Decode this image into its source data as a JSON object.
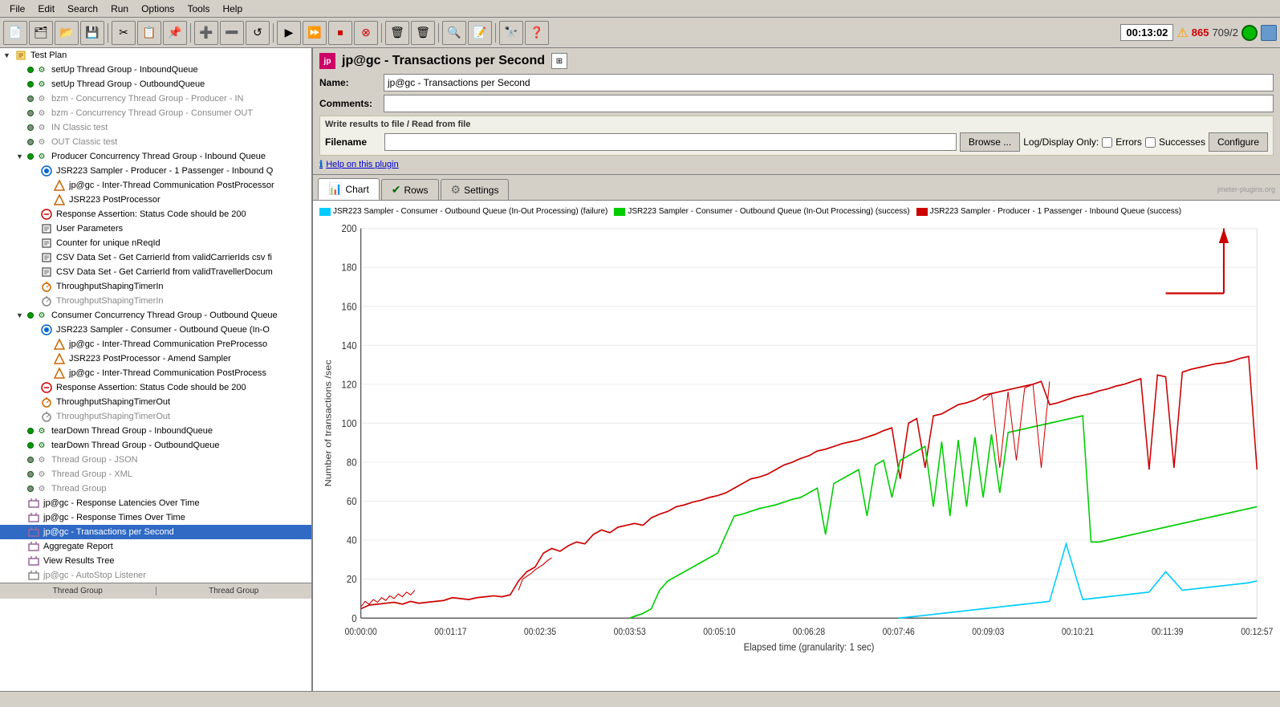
{
  "menubar": {
    "items": [
      "File",
      "Edit",
      "Search",
      "Run",
      "Options",
      "Tools",
      "Help"
    ]
  },
  "toolbar": {
    "timer": "00:13:02",
    "error_count": "865",
    "success_count": "709/2",
    "buttons": [
      "new",
      "open",
      "save",
      "cut",
      "copy",
      "paste",
      "add",
      "remove",
      "reset",
      "play",
      "stop_r",
      "stop",
      "shutdown",
      "clear",
      "clear_all",
      "browse_script",
      "script2",
      "search",
      "help"
    ]
  },
  "plugin": {
    "title": "jp@gc - Transactions per Second",
    "name_label": "Name:",
    "name_value": "jp@gc - Transactions per Second",
    "comments_label": "Comments:",
    "comments_value": "",
    "write_section_title": "Write results to file / Read from file",
    "filename_label": "Filename",
    "filename_value": "",
    "browse_label": "Browse ...",
    "log_display_label": "Log/Display Only:",
    "errors_label": "Errors",
    "successes_label": "Successes",
    "configure_label": "Configure",
    "help_text": "Help on this plugin"
  },
  "tabs": [
    {
      "label": "Chart",
      "active": true
    },
    {
      "label": "Rows",
      "active": false
    },
    {
      "label": "Settings",
      "active": false
    }
  ],
  "legend": [
    {
      "color": "#00ccff",
      "label": "JSR223 Sampler - Consumer - Outbound Queue (In-Out Processing) (failure)"
    },
    {
      "color": "#00cc00",
      "label": "JSR223 Sampler - Consumer - Outbound Queue (In-Out Processing) (success)"
    },
    {
      "color": "#cc0000",
      "label": "JSR223 Sampler - Producer - 1 Passenger - Inbound Queue (success)"
    }
  ],
  "chart": {
    "y_axis_label": "Number of transactions /sec",
    "x_axis_label": "Elapsed time (granularity: 1 sec)",
    "y_ticks": [
      "0",
      "20",
      "40",
      "60",
      "80",
      "100",
      "120",
      "140",
      "160",
      "180",
      "200"
    ],
    "x_ticks": [
      "00:00:00",
      "00:01:17",
      "00:02:35",
      "00:03:53",
      "00:05:10",
      "00:06:28",
      "00:07:46",
      "00:09:03",
      "00:10:21",
      "00:11:39",
      "00:12:57"
    ]
  },
  "tree": {
    "items": [
      {
        "id": "test-plan",
        "label": "Test Plan",
        "level": 0,
        "type": "plan",
        "expanded": true
      },
      {
        "id": "setup-inbound",
        "label": "setUp Thread Group - InboundQueue",
        "level": 1,
        "type": "thread-group"
      },
      {
        "id": "setup-outbound",
        "label": "setUp Thread Group - OutboundQueue",
        "level": 1,
        "type": "thread-group"
      },
      {
        "id": "bzm-producer",
        "label": "bzm - Concurrency Thread Group - Producer - IN",
        "level": 1,
        "type": "thread-group",
        "disabled": true
      },
      {
        "id": "bzm-consumer",
        "label": "bzm - Concurrency Thread Group - Consumer OUT",
        "level": 1,
        "type": "thread-group",
        "disabled": true
      },
      {
        "id": "in-classic",
        "label": "IN Classic test",
        "level": 1,
        "type": "thread-group",
        "disabled": true
      },
      {
        "id": "out-classic",
        "label": "OUT Classic test",
        "level": 1,
        "type": "thread-group",
        "disabled": true
      },
      {
        "id": "producer-concurrency",
        "label": "Producer Concurrency Thread Group - Inbound Queue",
        "level": 1,
        "type": "thread-group",
        "expanded": true
      },
      {
        "id": "jsr223-producer",
        "label": "JSR223 Sampler - Producer - 1 Passenger - Inbound Q",
        "level": 2,
        "type": "sampler"
      },
      {
        "id": "jp-inter-post",
        "label": "jp@gc - Inter-Thread Communication PostProcessor",
        "level": 3,
        "type": "preprocessor"
      },
      {
        "id": "jsr223-post",
        "label": "JSR223 PostProcessor",
        "level": 3,
        "type": "postprocessor"
      },
      {
        "id": "response-assert",
        "label": "Response Assertion: Status Code should be 200",
        "level": 2,
        "type": "assertion"
      },
      {
        "id": "user-params",
        "label": "User Parameters",
        "level": 2,
        "type": "config"
      },
      {
        "id": "counter",
        "label": "Counter for unique nReqId",
        "level": 2,
        "type": "config"
      },
      {
        "id": "csv-carrier",
        "label": "CSV Data Set - Get CarrierId from validCarrierIds csv fi",
        "level": 2,
        "type": "config"
      },
      {
        "id": "csv-traveller",
        "label": "CSV Data Set - Get CarrierId from validTravellerDocum",
        "level": 2,
        "type": "config"
      },
      {
        "id": "throughput-in",
        "label": "ThroughputShapingTimerIn",
        "level": 2,
        "type": "timer"
      },
      {
        "id": "throughput-in2",
        "label": "ThroughputShapingTimerIn",
        "level": 2,
        "type": "timer",
        "disabled": true
      },
      {
        "id": "consumer-concurrency",
        "label": "Consumer Concurrency Thread Group - Outbound Queue",
        "level": 1,
        "type": "thread-group",
        "expanded": true
      },
      {
        "id": "jsr223-consumer",
        "label": "JSR223 Sampler - Consumer - Outbound Queue (In-O",
        "level": 2,
        "type": "sampler"
      },
      {
        "id": "jp-inter-pre",
        "label": "jp@gc - Inter-Thread Communication PreProcesso",
        "level": 3,
        "type": "preprocessor"
      },
      {
        "id": "jsr223-amend",
        "label": "JSR223 PostProcessor - Amend Sampler",
        "level": 3,
        "type": "postprocessor"
      },
      {
        "id": "jp-inter-post2",
        "label": "jp@gc - Inter-Thread Communication PostProcess",
        "level": 3,
        "type": "postprocessor"
      },
      {
        "id": "response-assert2",
        "label": "Response Assertion: Status Code should be 200",
        "level": 2,
        "type": "assertion"
      },
      {
        "id": "throughput-out",
        "label": "ThroughputShapingTimerOut",
        "level": 2,
        "type": "timer"
      },
      {
        "id": "throughput-out2",
        "label": "ThroughputShapingTimerOut",
        "level": 2,
        "type": "timer",
        "disabled": true
      },
      {
        "id": "teardown-inbound",
        "label": "tearDown Thread Group - InboundQueue",
        "level": 1,
        "type": "thread-group"
      },
      {
        "id": "teardown-outbound",
        "label": "tearDown Thread Group - OutboundQueue",
        "level": 1,
        "type": "thread-group"
      },
      {
        "id": "thread-json",
        "label": "Thread Group - JSON",
        "level": 1,
        "type": "thread-group",
        "disabled": true
      },
      {
        "id": "thread-xml",
        "label": "Thread Group - XML",
        "level": 1,
        "type": "thread-group",
        "disabled": true
      },
      {
        "id": "thread-group",
        "label": "Thread Group",
        "level": 1,
        "type": "thread-group",
        "disabled": true
      },
      {
        "id": "jp-latencies",
        "label": "jp@gc - Response Latencies Over Time",
        "level": 1,
        "type": "listener"
      },
      {
        "id": "jp-response-times",
        "label": "jp@gc - Response Times Over Time",
        "level": 1,
        "type": "listener"
      },
      {
        "id": "jp-transactions",
        "label": "jp@gc - Transactions per Second",
        "level": 1,
        "type": "listener",
        "selected": true
      },
      {
        "id": "aggregate",
        "label": "Aggregate Report",
        "level": 1,
        "type": "listener"
      },
      {
        "id": "view-results",
        "label": "View Results Tree",
        "level": 1,
        "type": "listener"
      },
      {
        "id": "autostop",
        "label": "jp@gc - AutoStop Listener",
        "level": 1,
        "type": "listener",
        "disabled": true
      }
    ]
  },
  "status_bar": {
    "text": ""
  }
}
